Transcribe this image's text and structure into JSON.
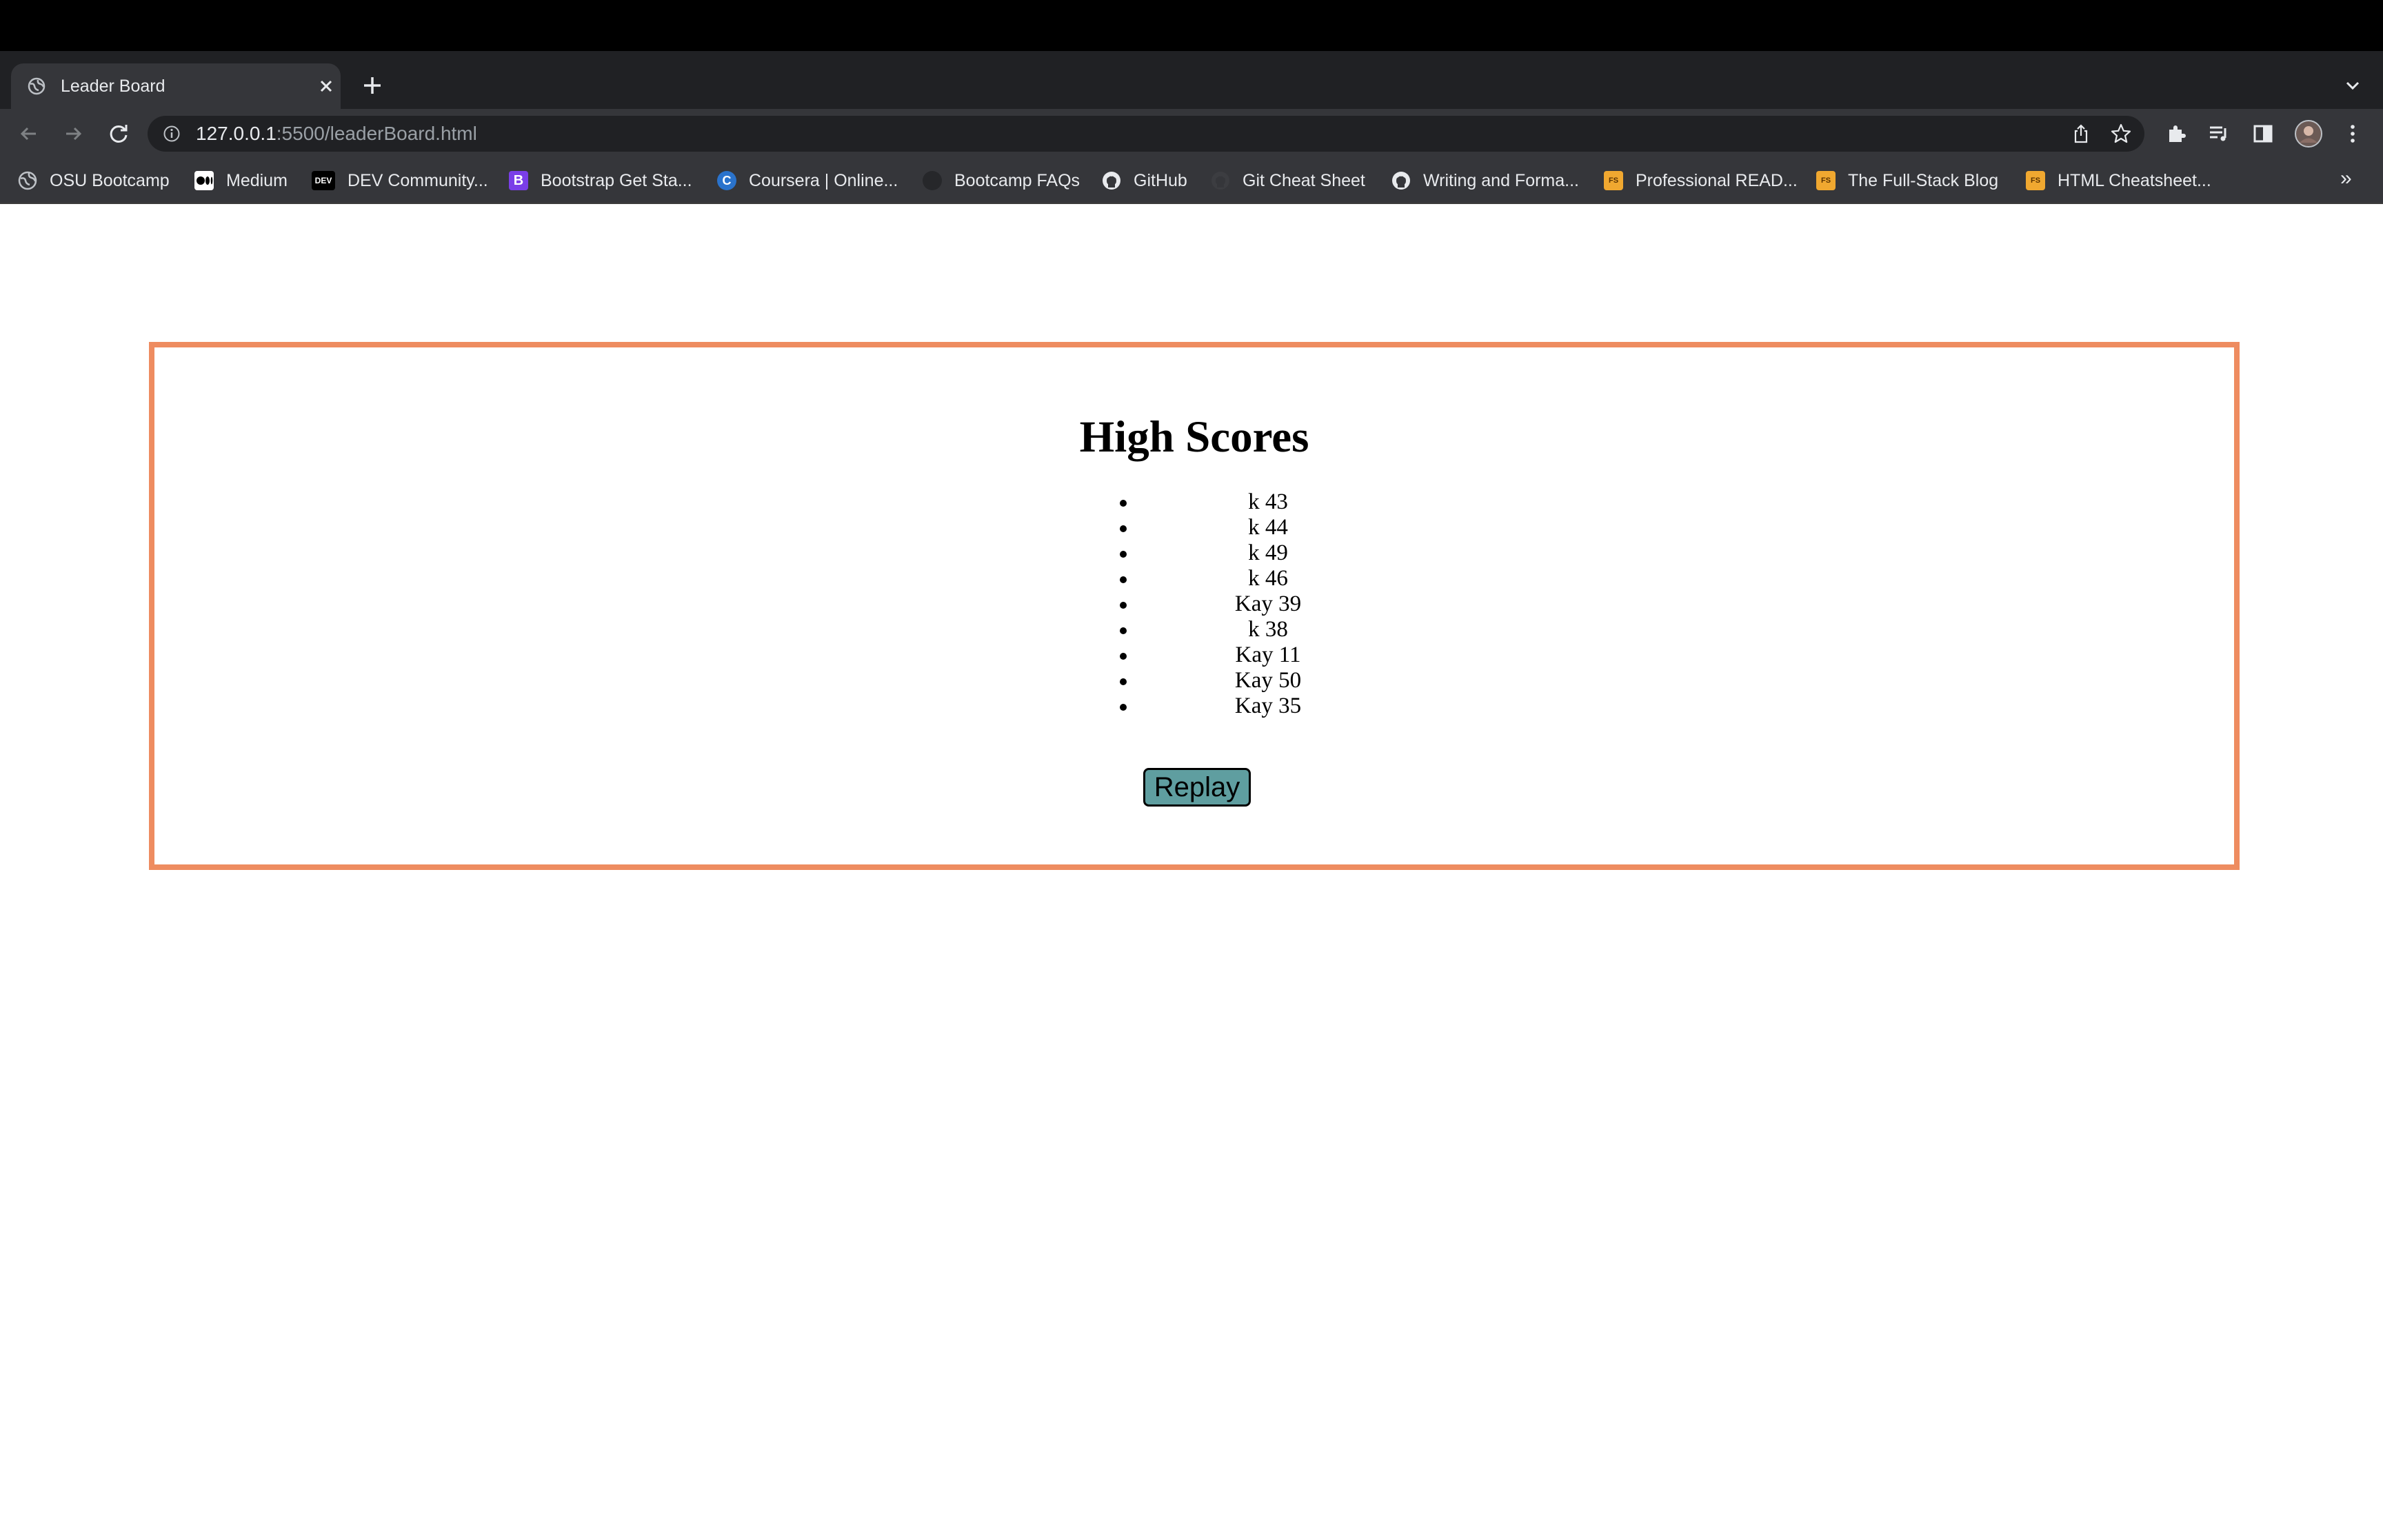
{
  "browser": {
    "tab": {
      "title": "Leader Board"
    },
    "address": {
      "host": "127.0.0.1",
      "path": ":5500/leaderBoard.html"
    },
    "bookmarks": [
      {
        "label": "OSU Bootcamp",
        "icon": "globe-icon"
      },
      {
        "label": "Medium",
        "icon": "medium-icon"
      },
      {
        "label": "DEV Community...",
        "icon": "dev-icon",
        "badge": "DEV"
      },
      {
        "label": "Bootstrap Get Sta...",
        "icon": "bootstrap-icon",
        "badge": "B"
      },
      {
        "label": "Coursera | Online...",
        "icon": "coursera-icon",
        "badge": "C"
      },
      {
        "label": "Bootcamp FAQs",
        "icon": "bootcamp-icon"
      },
      {
        "label": "GitHub",
        "icon": "github-icon"
      },
      {
        "label": "Git Cheat Sheet",
        "icon": "github-icon"
      },
      {
        "label": "Writing and Forma...",
        "icon": "github-icon"
      },
      {
        "label": "Professional READ...",
        "icon": "fs-icon",
        "badge": "FS"
      },
      {
        "label": "The Full-Stack Blog",
        "icon": "fs-icon",
        "badge": "FS"
      },
      {
        "label": "HTML Cheatsheet...",
        "icon": "fs-icon",
        "badge": "FS"
      }
    ],
    "bookmarks_overflow": "»"
  },
  "page": {
    "heading": "High Scores",
    "scores": [
      "k 43",
      "k 44",
      "k 49",
      "k 46",
      "Kay 39",
      "k 38",
      "Kay 11",
      "Kay 50",
      "Kay 35"
    ],
    "replay_label": "Replay"
  },
  "colors": {
    "card_border": "#ee8c60",
    "replay_button": "#5f9ea0",
    "chrome_dark": "#202124",
    "chrome_toolbar": "#35363a"
  }
}
